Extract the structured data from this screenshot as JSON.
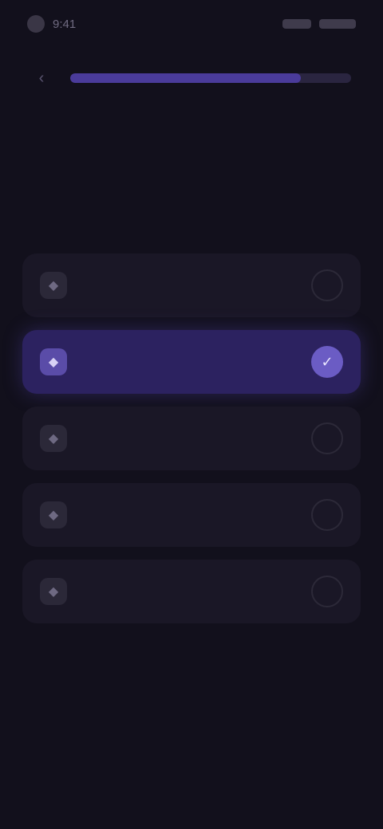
{
  "status_bar": {
    "time": "9:41"
  },
  "progress": {
    "percent": 82,
    "back_icon": "chevron-left-icon"
  },
  "question": {
    "title": "",
    "subtitle": ""
  },
  "options": [
    {
      "label": "",
      "icon": "option-icon",
      "selected": false
    },
    {
      "label": "",
      "icon": "option-icon",
      "selected": true
    },
    {
      "label": "",
      "icon": "option-icon",
      "selected": false
    },
    {
      "label": "",
      "icon": "option-icon",
      "selected": false
    },
    {
      "label": "",
      "icon": "option-icon",
      "selected": false
    }
  ],
  "colors": {
    "background": "#12101c",
    "accent": "#6b5cc4",
    "selected_card": "#2c2260"
  }
}
